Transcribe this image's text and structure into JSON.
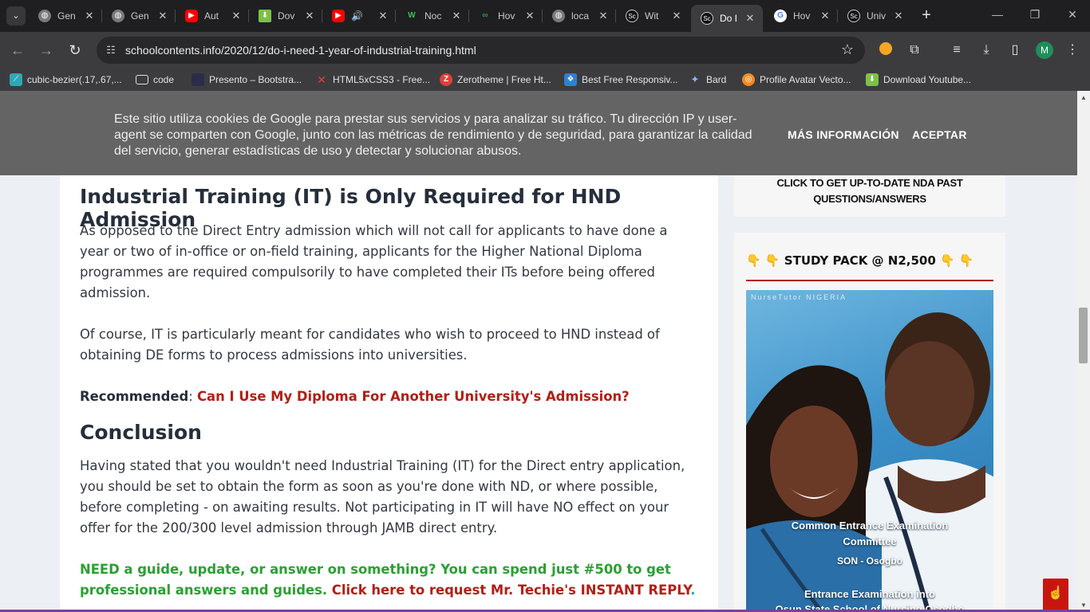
{
  "browser": {
    "tabs": [
      {
        "title": "Gen",
        "favicon": "globe-icon"
      },
      {
        "title": "Gen",
        "favicon": "globe-icon"
      },
      {
        "title": "Aut",
        "favicon": "youtube-icon"
      },
      {
        "title": "Dov",
        "favicon": "download-icon"
      },
      {
        "title": "",
        "favicon": "youtube-icon",
        "audio": "speaker-icon"
      },
      {
        "title": "Noc",
        "favicon": "w-icon"
      },
      {
        "title": "Hov",
        "favicon": "loop-icon"
      },
      {
        "title": "loca",
        "favicon": "globe-icon"
      },
      {
        "title": "Wit",
        "favicon": "sc-icon"
      },
      {
        "title": "Do I",
        "favicon": "sc-icon",
        "active": true
      },
      {
        "title": "Hov",
        "favicon": "google-icon"
      },
      {
        "title": "Univ",
        "favicon": "sc-icon"
      }
    ],
    "url": "schoolcontents.info/2020/12/do-i-need-1-year-of-industrial-training.html",
    "profile_initial": "M",
    "bookmarks": [
      "cubic-bezier(.17,.67,...",
      "code",
      "Presento – Bootstra...",
      "HTML5xCSS3 - Free...",
      "Zerotheme | Free Ht...",
      "Best Free Responsiv...",
      "Bard",
      "Profile Avatar Vecto...",
      "Download Youtube..."
    ]
  },
  "cookie_banner": {
    "text": "Este sitio utiliza cookies de Google para prestar sus servicios y para analizar su tráfico. Tu dirección IP y user-agent se comparten con Google, junto con las métricas de rendimiento y de seguridad, para garantizar la calidad del servicio, generar estadísticas de uso y detectar y solucionar abusos.",
    "more_info": "MÁS INFORMACIÓN",
    "accept": "ACEPTAR"
  },
  "article": {
    "heading_it": "Industrial Training (IT) is Only Required for HND Admission",
    "para1": "As opposed to the Direct Entry admission which will not call for applicants to have done a year or two of in-office or on-field training, applicants for the Higher National Diploma programmes are required compulsorily to have completed their ITs before being offered admission.",
    "para2": "Of course, IT is particularly meant for candidates who wish to proceed to HND instead of obtaining DE forms to process admissions into universities.",
    "recommended_label": "Recommended",
    "recommended_sep": ": ",
    "recommended_link": "Can I Use My Diploma For Another University's Admission?",
    "heading_conclusion": "Conclusion",
    "para3": "Having stated that you wouldn't need Industrial Training (IT) for the Direct entry application, you should be set to obtain the form as soon as you're done with ND, or where possible, before completing - on awaiting results. Not participating in IT will have NO effect on your offer for the 200/300 level admission through JAMB direct entry.",
    "cta_green": "NEED a guide, update, or answer on something? You can spend just #500 to get professional answers and guides. ",
    "cta_link": "Click here to request Mr. Techie's INSTANT REPLY",
    "cta_end": "."
  },
  "sidebar": {
    "nda_link": "CLICK TO GET UP-TO-DATE NDA PAST QUESTIONS/ANSWERS",
    "study_pack_title": "👇 👇 STUDY PACK @ N2,500 👇 👇",
    "study_pack_image": {
      "brand": "NurseTutor NIGERIA",
      "line1": "Common Entrance Examination",
      "line2": "Committee",
      "line3": "SON - Osogbo",
      "line4": "Entrance Examination into",
      "line5": "Osun State School of Nursing Osogbo"
    }
  }
}
